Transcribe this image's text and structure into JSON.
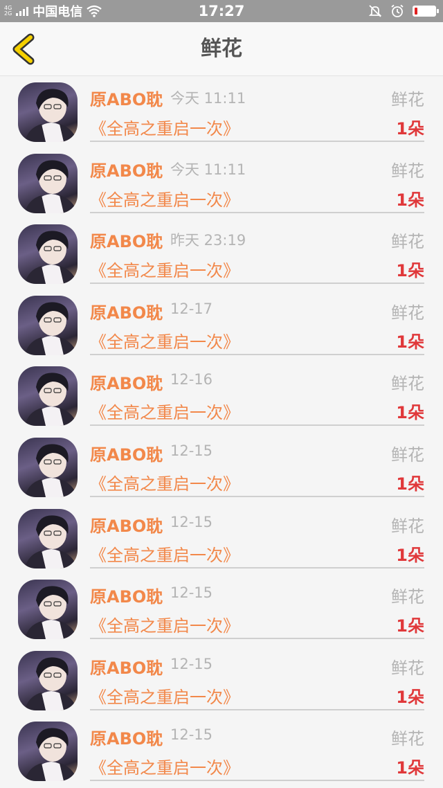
{
  "status_bar": {
    "network_top": "4G",
    "network_bottom": "2G",
    "carrier": "中国电信",
    "time": "17:27",
    "battery_percent": 15
  },
  "header": {
    "back_icon": "chevron-left-icon",
    "title": "鲜花"
  },
  "records": [
    {
      "user": "原ABO耽",
      "time": "今天 11:11",
      "gift_type": "鲜花",
      "book": "《全高之重启一次》",
      "amount": "1朵"
    },
    {
      "user": "原ABO耽",
      "time": "今天 11:11",
      "gift_type": "鲜花",
      "book": "《全高之重启一次》",
      "amount": "1朵"
    },
    {
      "user": "原ABO耽",
      "time": "昨天 23:19",
      "gift_type": "鲜花",
      "book": "《全高之重启一次》",
      "amount": "1朵"
    },
    {
      "user": "原ABO耽",
      "time": "12-17",
      "gift_type": "鲜花",
      "book": "《全高之重启一次》",
      "amount": "1朵"
    },
    {
      "user": "原ABO耽",
      "time": "12-16",
      "gift_type": "鲜花",
      "book": "《全高之重启一次》",
      "amount": "1朵"
    },
    {
      "user": "原ABO耽",
      "time": "12-15",
      "gift_type": "鲜花",
      "book": "《全高之重启一次》",
      "amount": "1朵"
    },
    {
      "user": "原ABO耽",
      "time": "12-15",
      "gift_type": "鲜花",
      "book": "《全高之重启一次》",
      "amount": "1朵"
    },
    {
      "user": "原ABO耽",
      "time": "12-15",
      "gift_type": "鲜花",
      "book": "《全高之重启一次》",
      "amount": "1朵"
    },
    {
      "user": "原ABO耽",
      "time": "12-15",
      "gift_type": "鲜花",
      "book": "《全高之重启一次》",
      "amount": "1朵"
    },
    {
      "user": "原ABO耽",
      "time": "12-15",
      "gift_type": "鲜花",
      "book": "《全高之重启一次》",
      "amount": "1朵"
    }
  ],
  "colors": {
    "accent_orange": "#f2884a",
    "amount_red": "#e0383a",
    "back_yellow": "#f5d000"
  }
}
